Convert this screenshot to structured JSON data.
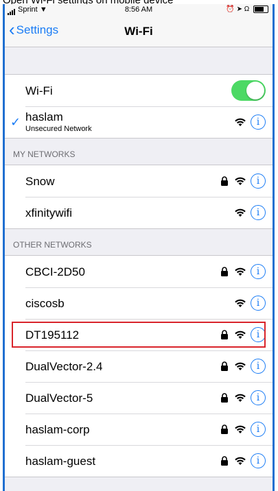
{
  "caption": "Open Wi-Fi settings on mobile device",
  "status_bar": {
    "carrier": "Sprint",
    "time": "8:56 AM"
  },
  "nav": {
    "back_label": "Settings",
    "title": "Wi-Fi"
  },
  "wifi_toggle": {
    "label": "Wi-Fi",
    "on": true
  },
  "connected": {
    "name": "haslam",
    "subtitle": "Unsecured Network"
  },
  "my_networks_header": "MY NETWORKS",
  "my_networks": [
    {
      "name": "Snow",
      "locked": true
    },
    {
      "name": "xfinitywifi",
      "locked": false
    }
  ],
  "other_networks_header": "OTHER NETWORKS",
  "other_networks": [
    {
      "name": "CBCI-2D50",
      "locked": true
    },
    {
      "name": "ciscosb",
      "locked": false
    },
    {
      "name": "DT195112",
      "locked": true,
      "highlighted": true
    },
    {
      "name": "DualVector-2.4",
      "locked": true
    },
    {
      "name": "DualVector-5",
      "locked": true
    },
    {
      "name": "haslam-corp",
      "locked": true
    },
    {
      "name": "haslam-guest",
      "locked": true
    }
  ],
  "colors": {
    "accent": "#1a7cf5",
    "toggle_on": "#4cd964",
    "highlight": "#d9242b"
  }
}
